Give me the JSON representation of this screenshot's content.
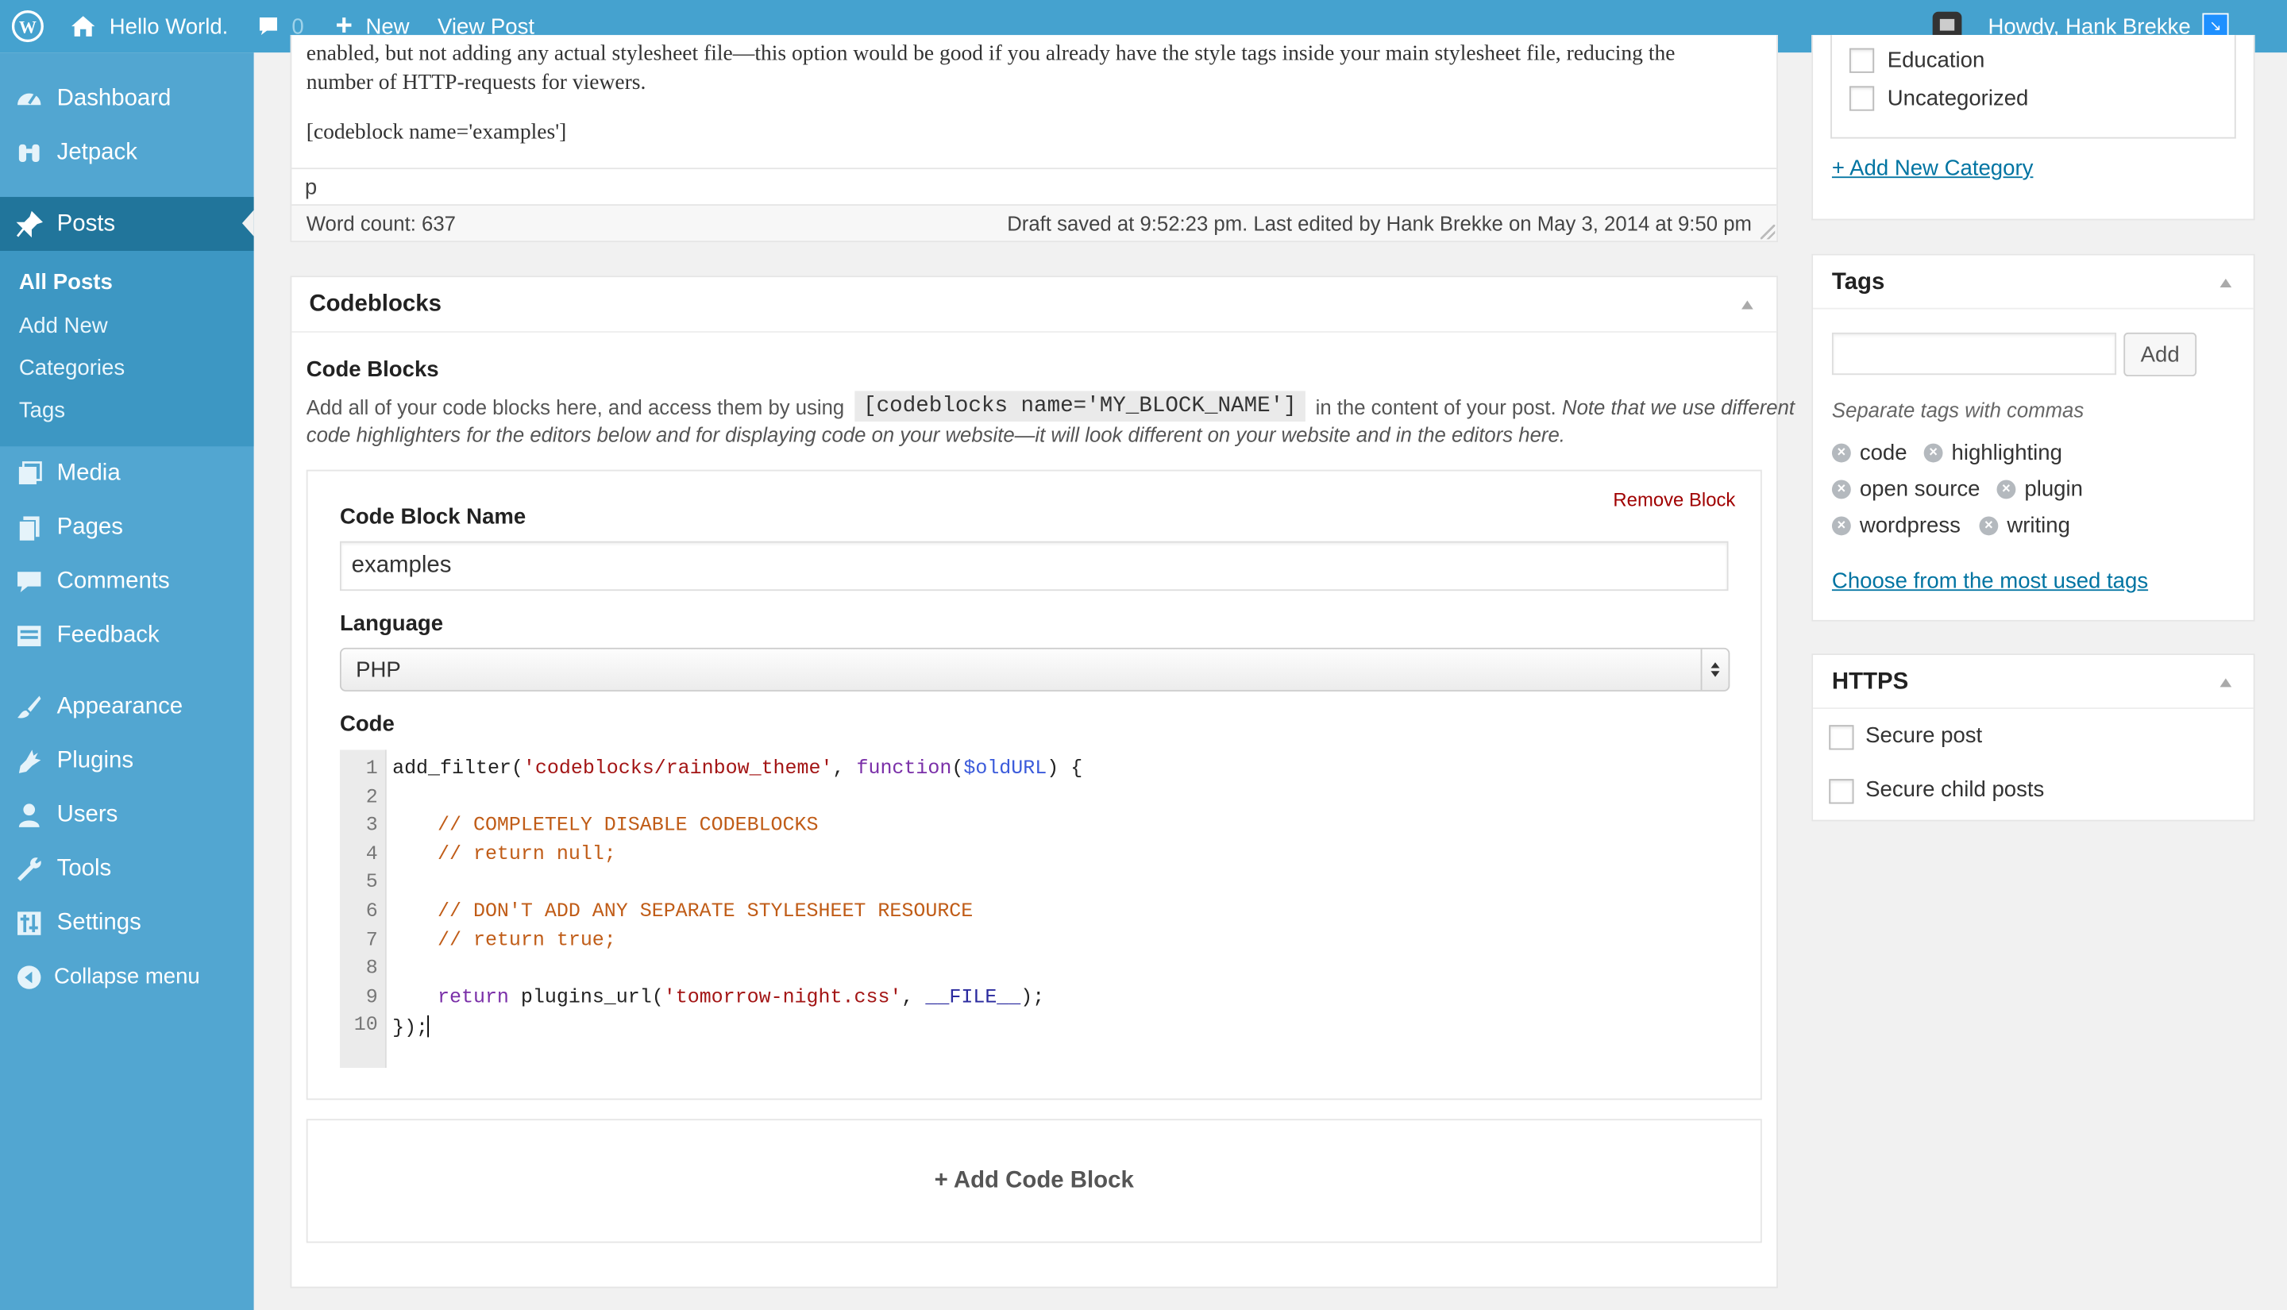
{
  "colors": {
    "admin_bar": "#45a2cf",
    "sidebar": "#52a6d1",
    "sidebar_current": "#21759b",
    "remove_link": "#a00000",
    "link": "#0074a2"
  },
  "admin_bar": {
    "site_name": "Hello World.",
    "comments_count": "0",
    "new_label": "New",
    "view_post_label": "View Post",
    "howdy": "Howdy, Hank Brekke"
  },
  "sidebar": {
    "items": [
      {
        "label": "Dashboard",
        "icon": "dashboard-icon"
      },
      {
        "label": "Jetpack",
        "icon": "jetpack-icon"
      },
      {
        "label": "Posts",
        "icon": "pin-icon"
      },
      {
        "label": "Media",
        "icon": "media-icon"
      },
      {
        "label": "Pages",
        "icon": "pages-icon"
      },
      {
        "label": "Comments",
        "icon": "comment-icon"
      },
      {
        "label": "Feedback",
        "icon": "feedback-icon"
      },
      {
        "label": "Appearance",
        "icon": "brush-icon"
      },
      {
        "label": "Plugins",
        "icon": "plug-icon"
      },
      {
        "label": "Users",
        "icon": "user-icon"
      },
      {
        "label": "Tools",
        "icon": "wrench-icon"
      },
      {
        "label": "Settings",
        "icon": "settings-icon"
      },
      {
        "label": "Collapse menu",
        "icon": "collapse-icon"
      }
    ],
    "posts_submenu": [
      "All Posts",
      "Add New",
      "Categories",
      "Tags"
    ]
  },
  "editor": {
    "text_line1": "enabled, but not adding any actual stylesheet file—this option would be good if you already have the style tags inside your main stylesheet file, reducing the",
    "text_line2": "number of HTTP-requests for viewers.",
    "shortcode": "[codeblock name='examples']",
    "path": "p",
    "word_count": "Word count: 637",
    "draft_status": "Draft saved at 9:52:23 pm. Last edited by Hank Brekke on May 3, 2014 at 9:50 pm"
  },
  "codeblocks": {
    "box_title": "Codeblocks",
    "section_title": "Code Blocks",
    "desc_before": "Add all of your code blocks here, and access them by using",
    "desc_code": "[codeblocks name='MY_BLOCK_NAME']",
    "desc_after": "in the content of your post.",
    "desc_note_1": "Note that we use different",
    "desc_note_2": "code highlighters for the editors below and for displaying code on your website—it will look different on your website and in the editors here.",
    "remove_block": "Remove Block",
    "name_label": "Code Block Name",
    "name_value": "examples",
    "language_label": "Language",
    "language_value": "PHP",
    "code_label": "Code",
    "line_numbers": [
      "1",
      "2",
      "3",
      "4",
      "5",
      "6",
      "7",
      "8",
      "9",
      "10"
    ],
    "code": {
      "l1_a": "add_filter(",
      "l1_b": "'codeblocks/rainbow_theme'",
      "l1_c": ", ",
      "l1_d": "function",
      "l1_e": "(",
      "l1_f": "$oldURL",
      "l1_g": ") {",
      "l3": "// COMPLETELY DISABLE CODEBLOCKS",
      "l4": "// return null;",
      "l6": "// DON'T ADD ANY SEPARATE STYLESHEET RESOURCE",
      "l7": "// return true;",
      "l9_a": "return",
      "l9_b": " plugins_url(",
      "l9_c": "'tomorrow-night.css'",
      "l9_d": ", ",
      "l9_e": "__FILE__",
      "l9_f": ");",
      "l10": "});"
    },
    "add_block": "+ Add Code Block"
  },
  "categories": {
    "items": [
      "Education",
      "Uncategorized"
    ],
    "add_new": "+ Add New Category"
  },
  "tags": {
    "title": "Tags",
    "add_button": "Add",
    "hint": "Separate tags with commas",
    "items": [
      "code",
      "highlighting",
      "open source",
      "plugin",
      "wordpress",
      "writing"
    ],
    "choose_link": "Choose from the most used tags"
  },
  "https": {
    "title": "HTTPS",
    "options": [
      "Secure post",
      "Secure child posts"
    ]
  }
}
